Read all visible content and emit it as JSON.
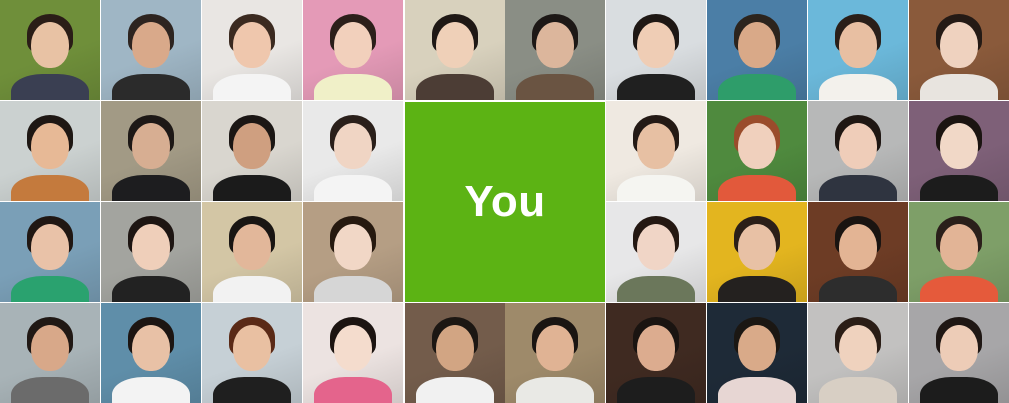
{
  "center_tile": {
    "label": "You",
    "color": "#5cb314"
  },
  "photo_tiles": [
    {
      "bg": "#6f8f3a",
      "skin": "#e8c2a4",
      "hair": "#2a1d17",
      "top": "#3a3f52"
    },
    {
      "bg": "#9fb6c5",
      "skin": "#d9a98a",
      "hair": "#2d2420",
      "top": "#2b2b2b"
    },
    {
      "bg": "#e9e6e3",
      "skin": "#efc7ad",
      "hair": "#3b2a20",
      "top": "#f4f4f4"
    },
    {
      "bg": "#e49ab7",
      "skin": "#f2d0bc",
      "hair": "#2c1f1a",
      "top": "#f0f0c8"
    },
    {
      "bg": "#d8d1bd",
      "skin": "#efd0b8",
      "hair": "#1f1815",
      "top": "#4c3d35"
    },
    {
      "bg": "#8a8e85",
      "skin": "#dcb69c",
      "hair": "#1d1816",
      "top": "#6a5442"
    },
    {
      "bg": "#d9dde0",
      "skin": "#efcdb5",
      "hair": "#1e1714",
      "top": "#202020"
    },
    {
      "bg": "#4b7ea6",
      "skin": "#d9a988",
      "hair": "#2c241d",
      "top": "#2e9d6a"
    },
    {
      "bg": "#6bb8da",
      "skin": "#e8bfa2",
      "hair": "#2a1f19",
      "top": "#f3f1ec"
    },
    {
      "bg": "#8a5a3b",
      "skin": "#efd2bf",
      "hair": "#241a15",
      "top": "#e8e4df"
    },
    {
      "bg": "#cbd1d0",
      "skin": "#e7b996",
      "hair": "#1e1713",
      "top": "#c47a3d"
    },
    {
      "bg": "#a29a85",
      "skin": "#d7ae92",
      "hair": "#1d1816",
      "top": "#1d1d1f"
    },
    {
      "bg": "#d9d6cf",
      "skin": "#cf9f80",
      "hair": "#1b1614",
      "top": "#1b1b1b"
    },
    {
      "bg": "#e9e9e9",
      "skin": "#f0d5c4",
      "hair": "#2a1f1a",
      "top": "#f4f4f4"
    },
    {
      "bg": "#efe9e1",
      "skin": "#e7c0a3",
      "hair": "#241a15",
      "top": "#f5f5f1"
    },
    {
      "bg": "#4f8a3e",
      "skin": "#f0d0bd",
      "hair": "#9a4c2b",
      "top": "#e2593b"
    },
    {
      "bg": "#b7b8b8",
      "skin": "#efcdb9",
      "hair": "#1f1713",
      "top": "#2f3440"
    },
    {
      "bg": "#7e6078",
      "skin": "#f1d8c7",
      "hair": "#1b1411",
      "top": "#1c1c1c"
    },
    {
      "bg": "#7a9fb7",
      "skin": "#e9c2a8",
      "hair": "#201713",
      "top": "#2aa26f"
    },
    {
      "bg": "#a3a49f",
      "skin": "#efcfba",
      "hair": "#1d1512",
      "top": "#222222"
    },
    {
      "bg": "#d3c6a5",
      "skin": "#e2b79a",
      "hair": "#191513",
      "top": "#f2f2f2"
    },
    {
      "bg": "#b59e84",
      "skin": "#f1d7c6",
      "hair": "#26190f",
      "top": "#d6d6d6"
    },
    {
      "bg": "#e7e7e8",
      "skin": "#f0d5c6",
      "hair": "#241812",
      "top": "#6b775b"
    },
    {
      "bg": "#e3b51f",
      "skin": "#e8c1a5",
      "hair": "#2b1f18",
      "top": "#24211f"
    },
    {
      "bg": "#6d3c25",
      "skin": "#e3b494",
      "hair": "#1a1411",
      "top": "#2d2d2d"
    },
    {
      "bg": "#7e9f68",
      "skin": "#e2b496",
      "hair": "#2a1f1a",
      "top": "#e55a3b"
    },
    {
      "bg": "#a8b3b7",
      "skin": "#d8a889",
      "hair": "#201814",
      "top": "#6b6b6b"
    },
    {
      "bg": "#5f8ea9",
      "skin": "#e8c1a6",
      "hair": "#1c1512",
      "top": "#f3f3f3"
    },
    {
      "bg": "#c6d0d6",
      "skin": "#e9c0a2",
      "hair": "#5a2a17",
      "top": "#1f1f1f"
    },
    {
      "bg": "#ece3e1",
      "skin": "#f4dccd",
      "hair": "#1c1411",
      "top": "#e4648c"
    },
    {
      "bg": "#735c4b",
      "skin": "#d2a583",
      "hair": "#1c1713",
      "top": "#f1f1f1"
    },
    {
      "bg": "#9e8a6a",
      "skin": "#e0b394",
      "hair": "#1a1512",
      "top": "#e9e9e5"
    },
    {
      "bg": "#3f2a21",
      "skin": "#dcac8f",
      "hair": "#1a1411",
      "top": "#1d1d1d"
    },
    {
      "bg": "#1e2a37",
      "skin": "#d9aa89",
      "hair": "#1b1713",
      "top": "#e7d6d3"
    },
    {
      "bg": "#c2c1c0",
      "skin": "#efd2be",
      "hair": "#2a1d16",
      "top": "#d8cfc4"
    },
    {
      "bg": "#a7a6a8",
      "skin": "#edccb7",
      "hair": "#1f1714",
      "top": "#1c1c1c"
    }
  ]
}
